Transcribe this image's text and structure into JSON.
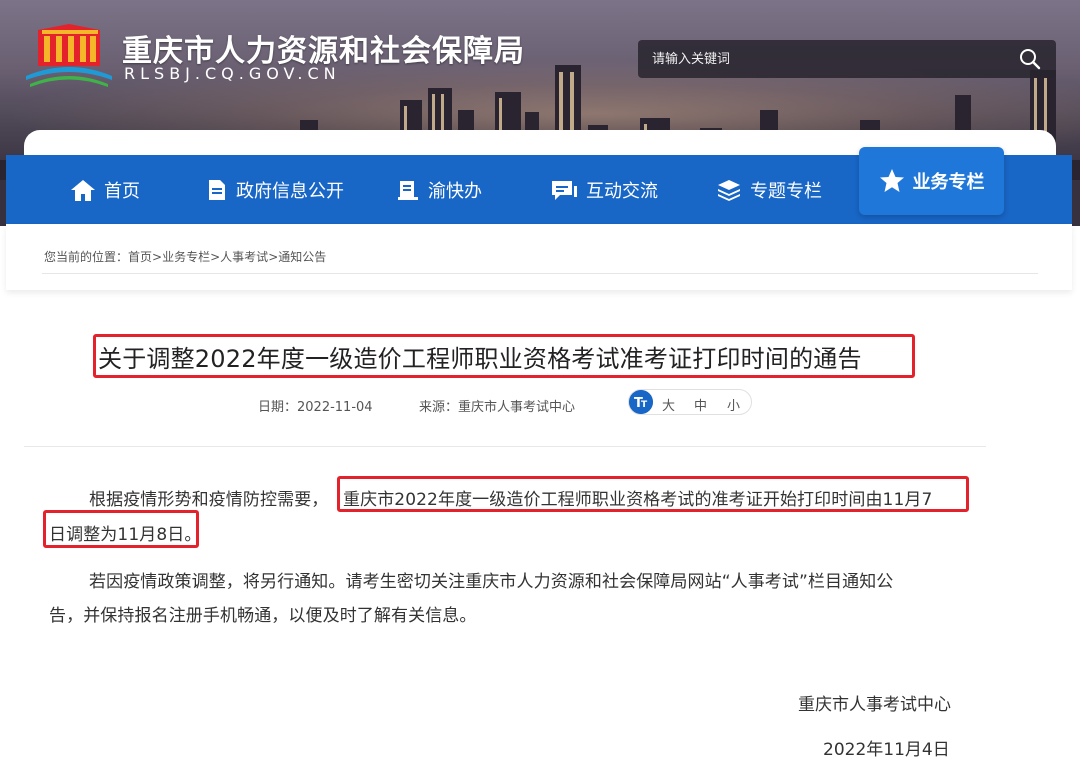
{
  "header": {
    "site_title": "重庆市人力资源和社会保障局",
    "site_domain": "RLSBJ.CQ.GOV.CN",
    "search_placeholder": "请输入关键词"
  },
  "nav": {
    "items": [
      {
        "label": "首页",
        "icon": "home-icon"
      },
      {
        "label": "政府信息公开",
        "icon": "document-icon"
      },
      {
        "label": "渝快办",
        "icon": "clipboard-icon"
      },
      {
        "label": "互动交流",
        "icon": "chat-icon"
      },
      {
        "label": "专题专栏",
        "icon": "layers-icon"
      },
      {
        "label": "业务专栏",
        "icon": "star-icon",
        "active": true
      }
    ]
  },
  "breadcrumb": {
    "prefix": "您当前的位置：",
    "items": [
      "首页",
      "业务专栏",
      "人事考试",
      "通知公告"
    ],
    "separator": ">"
  },
  "article": {
    "title": "关于调整2022年度一级造价工程师职业资格考试准考证打印时间的通告",
    "date_label": "日期：",
    "date": "2022-11-04",
    "source_label": "来源：",
    "source": "重庆市人事考试中心",
    "font_size_options": [
      "大",
      "中",
      "小"
    ],
    "p1_start": "根据疫情形势和疫情防控需要，",
    "p1_highlight_line1": "重庆市2022年度一级造价工程师职业资格考试的准考证开始打印时间由11月7",
    "p1_highlight_line2": "日调整为11月8日。",
    "p2_line1": "若因疫情政策调整，将另行通知。请考生密切关注重庆市人力资源和社会保障局网站“人事考试”栏目通知公",
    "p2_line2": "告，并保持报名注册手机畅通，以便及时了解有关信息。",
    "signature_org": "重庆市人事考试中心",
    "signature_date": "2022年11月4日"
  },
  "colors": {
    "nav_blue": "#1866c6",
    "nav_active": "#1f78d9",
    "highlight_red": "#e3222b"
  }
}
